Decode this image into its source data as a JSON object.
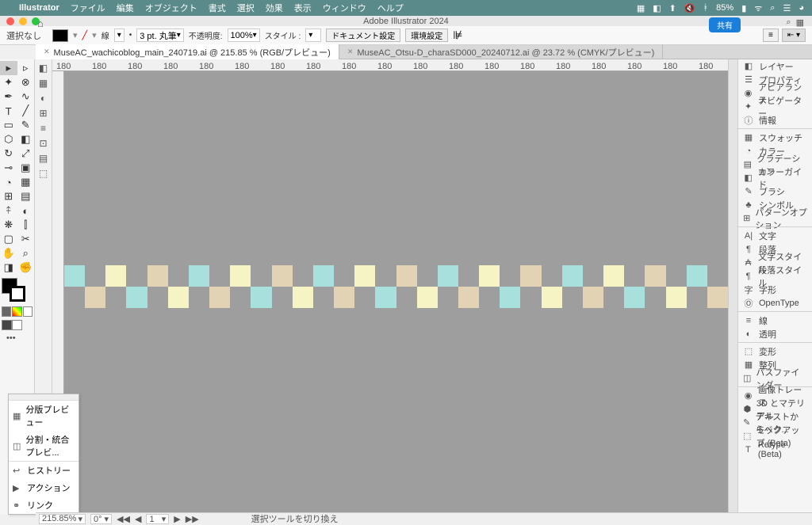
{
  "menubar": {
    "app": "Illustrator",
    "items": [
      "ファイル",
      "編集",
      "オブジェクト",
      "書式",
      "選択",
      "効果",
      "表示",
      "ウィンドウ",
      "ヘルプ"
    ],
    "right": {
      "battery": "85%",
      "clock": ""
    }
  },
  "window": {
    "title": "Adobe Illustrator 2024",
    "share": "共有"
  },
  "controlbar": {
    "selection": "選択なし",
    "stroke_label": "線",
    "stroke_pt": "3 pt. 丸筆",
    "opacity_label": "不透明度:",
    "opacity_val": "100%",
    "style_label": "スタイル :",
    "doc_setup": "ドキュメント設定",
    "env_setup": "環境設定"
  },
  "tabs": [
    {
      "label": "MuseAC_wachicoblog_main_240719.ai @ 215.85 % (RGB/プレビュー)",
      "active": true
    },
    {
      "label": "MuseAC_Otsu-D_charaSD000_20240712.ai @ 23.72 % (CMYK/プレビュー)",
      "active": false
    }
  ],
  "ruler_ticks": [
    "180",
    "180",
    "180",
    "180",
    "180",
    "180",
    "180",
    "180",
    "180",
    "180",
    "180",
    "180",
    "180",
    "180",
    "180",
    "180",
    "180",
    "180",
    "180",
    "180"
  ],
  "panels": {
    "g1": [
      "レイヤー",
      "プロパティ",
      "アピアランス",
      "ナビゲーター",
      "情報"
    ],
    "g2": [
      "スウォッチ",
      "カラー",
      "グラデーション",
      "カラーガイド",
      "ブラシ",
      "シンボル",
      "パターンオプション"
    ],
    "g3": [
      "文字",
      "段落",
      "文字スタイル",
      "段落スタイル",
      "字形",
      "OpenType"
    ],
    "g4": [
      "線",
      "透明"
    ],
    "g5": [
      "変形",
      "整列",
      "パスファインダー"
    ],
    "g6": [
      "画像トレース",
      "3D とマテリアル",
      "テキストからベク...",
      "モックアップ (Beta)",
      "Retype (Beta)"
    ]
  },
  "panel_icons": {
    "g1": [
      "◧",
      "☰",
      "◉",
      "✦",
      "ⓘ"
    ],
    "g2": [
      "▦",
      "◔",
      "▤",
      "◧",
      "✎",
      "♣",
      "⊞"
    ],
    "g3": [
      "A|",
      "¶",
      "₳",
      "¶",
      "字",
      "Ⓞ"
    ],
    "g4": [
      "≡",
      "◐"
    ],
    "g5": [
      "⬚",
      "▦",
      "◫"
    ],
    "g6": [
      "◉",
      "⬢",
      "✎",
      "⬚",
      "T"
    ]
  },
  "floating": [
    "分版プレビュー",
    "分割・統合プレビ..."
  ],
  "floating2": [
    "ヒストリー",
    "アクション",
    "リンク"
  ],
  "statusbar": {
    "zoom": "215.85%",
    "tool": "選択ツールを切り換え"
  },
  "pattern": {
    "row1": [
      0,
      null,
      1,
      null,
      2,
      null,
      0,
      null,
      1,
      null,
      2,
      null,
      0,
      null,
      1,
      null,
      2,
      null,
      0,
      null,
      1,
      null,
      2,
      null,
      0,
      null,
      1,
      null,
      2,
      null,
      0,
      null
    ],
    "row2": [
      null,
      2,
      null,
      0,
      null,
      1,
      null,
      2,
      null,
      0,
      null,
      1,
      null,
      2,
      null,
      0,
      null,
      1,
      null,
      2,
      null,
      0,
      null,
      1,
      null,
      2,
      null,
      0,
      null,
      1,
      null,
      2
    ]
  }
}
